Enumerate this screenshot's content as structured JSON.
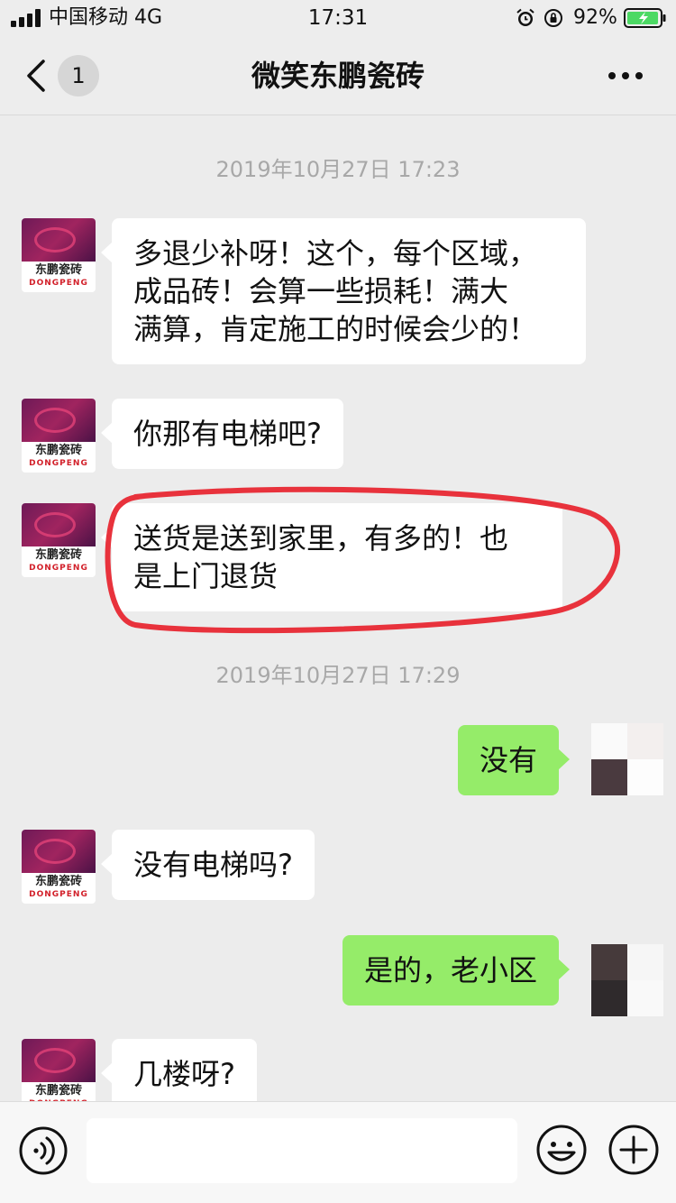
{
  "status_bar": {
    "carrier": "中国移动 4G",
    "time": "17:31",
    "battery": "92%"
  },
  "nav": {
    "unread_count": "1",
    "title": "微笑东鹏瓷砖"
  },
  "brand_avatar": {
    "name": "东鹏瓷砖",
    "name_en": "DONGPENG"
  },
  "chat": {
    "timestamps": [
      "2019年10月27日 17:23",
      "2019年10月27日 17:29"
    ],
    "messages": [
      {
        "side": "left",
        "text": "多退少补呀！这个，每个区域，\n成品砖！会算一些损耗！满大\n满算，肯定施工的时候会少的！"
      },
      {
        "side": "left",
        "text": "你那有电梯吧?"
      },
      {
        "side": "left",
        "text": "送货是送到家里，有多的！也\n是上门退货",
        "highlighted": true
      },
      {
        "side": "right",
        "text": "没有"
      },
      {
        "side": "left",
        "text": "没有电梯吗?"
      },
      {
        "side": "right",
        "text": "是的，老小区"
      },
      {
        "side": "left",
        "text": "几楼呀?"
      }
    ]
  },
  "input_bar": {
    "placeholder": ""
  },
  "icons": {
    "back": "chevron-left-icon",
    "more": "more-dots-icon",
    "voice": "voice-icon",
    "emoji": "emoji-icon",
    "plus": "plus-icon"
  },
  "colors": {
    "sent_bubble": "#95ec69",
    "received_bubble": "#ffffff",
    "chat_background": "#ececec",
    "highlight_ring": "#e8323c"
  }
}
